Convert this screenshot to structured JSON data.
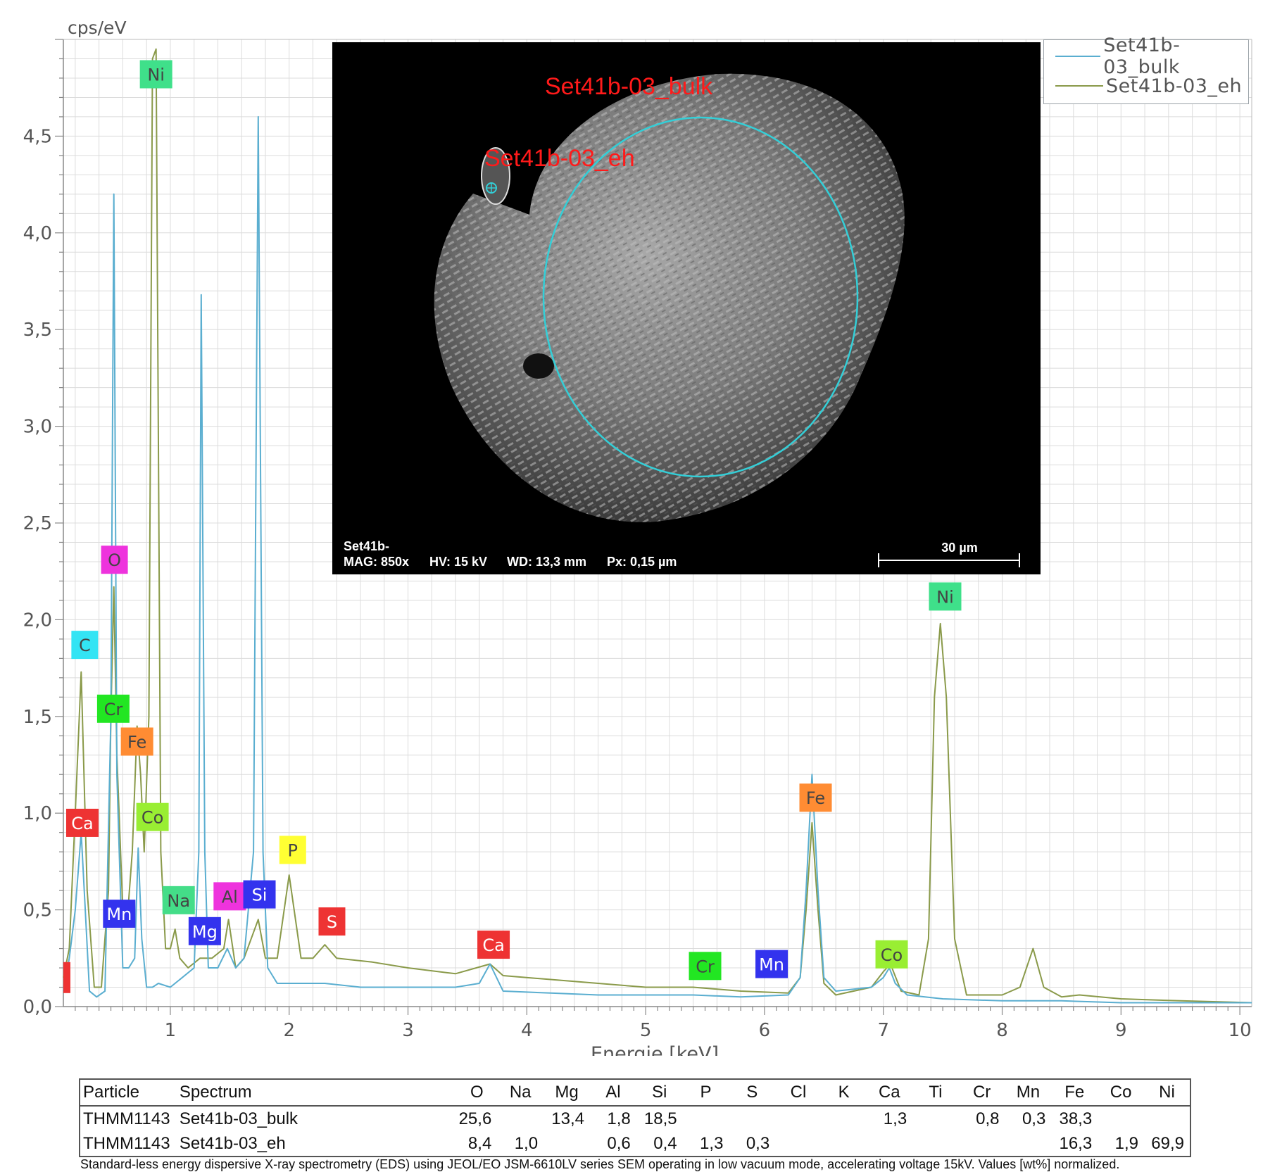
{
  "chart_data": {
    "type": "line",
    "ylabel": "cps/eV",
    "xlabel": "Energie [keV]",
    "xlim": [
      0.1,
      10.1
    ],
    "ylim": [
      0,
      5.0
    ],
    "x_ticks": [
      "1",
      "2",
      "3",
      "4",
      "5",
      "6",
      "7",
      "8",
      "9",
      "10"
    ],
    "y_ticks": [
      "0,0",
      "0,5",
      "1,0",
      "1,5",
      "2,0",
      "2,5",
      "3,0",
      "3,5",
      "4,0",
      "4,5"
    ],
    "grid": true,
    "legend_position": "top-right",
    "series": [
      {
        "name": "Set41b-03_bulk",
        "color": "#5aaed0",
        "points": [
          [
            0.1,
            0.08
          ],
          [
            0.15,
            0.25
          ],
          [
            0.2,
            0.5
          ],
          [
            0.25,
            0.9
          ],
          [
            0.28,
            0.55
          ],
          [
            0.32,
            0.08
          ],
          [
            0.38,
            0.05
          ],
          [
            0.45,
            0.08
          ],
          [
            0.5,
            1.5
          ],
          [
            0.525,
            4.2
          ],
          [
            0.55,
            1.2
          ],
          [
            0.6,
            0.2
          ],
          [
            0.65,
            0.2
          ],
          [
            0.7,
            0.25
          ],
          [
            0.73,
            0.82
          ],
          [
            0.76,
            0.35
          ],
          [
            0.8,
            0.1
          ],
          [
            0.85,
            0.1
          ],
          [
            0.9,
            0.12
          ],
          [
            1.0,
            0.1
          ],
          [
            1.1,
            0.15
          ],
          [
            1.2,
            0.2
          ],
          [
            1.24,
            0.8
          ],
          [
            1.26,
            3.68
          ],
          [
            1.29,
            0.8
          ],
          [
            1.32,
            0.2
          ],
          [
            1.4,
            0.2
          ],
          [
            1.48,
            0.3
          ],
          [
            1.55,
            0.2
          ],
          [
            1.62,
            0.25
          ],
          [
            1.7,
            0.8
          ],
          [
            1.74,
            4.6
          ],
          [
            1.78,
            0.8
          ],
          [
            1.82,
            0.2
          ],
          [
            1.9,
            0.12
          ],
          [
            2.0,
            0.12
          ],
          [
            2.3,
            0.12
          ],
          [
            2.6,
            0.1
          ],
          [
            3.0,
            0.1
          ],
          [
            3.4,
            0.1
          ],
          [
            3.6,
            0.12
          ],
          [
            3.69,
            0.22
          ],
          [
            3.8,
            0.08
          ],
          [
            4.2,
            0.07
          ],
          [
            4.6,
            0.06
          ],
          [
            5.0,
            0.06
          ],
          [
            5.4,
            0.06
          ],
          [
            5.8,
            0.05
          ],
          [
            6.2,
            0.06
          ],
          [
            6.3,
            0.15
          ],
          [
            6.35,
            0.6
          ],
          [
            6.4,
            1.2
          ],
          [
            6.45,
            0.6
          ],
          [
            6.5,
            0.15
          ],
          [
            6.6,
            0.08
          ],
          [
            6.9,
            0.1
          ],
          [
            7.0,
            0.15
          ],
          [
            7.05,
            0.2
          ],
          [
            7.1,
            0.12
          ],
          [
            7.2,
            0.06
          ],
          [
            7.5,
            0.04
          ],
          [
            8.0,
            0.03
          ],
          [
            8.5,
            0.03
          ],
          [
            9.0,
            0.02
          ],
          [
            10.1,
            0.02
          ]
        ]
      },
      {
        "name": "Set41b-03_eh",
        "color": "#8a9a4a",
        "points": [
          [
            0.1,
            0.15
          ],
          [
            0.15,
            0.3
          ],
          [
            0.2,
            1.0
          ],
          [
            0.25,
            1.73
          ],
          [
            0.3,
            0.6
          ],
          [
            0.36,
            0.1
          ],
          [
            0.42,
            0.1
          ],
          [
            0.48,
            0.6
          ],
          [
            0.5,
            1.5
          ],
          [
            0.525,
            2.17
          ],
          [
            0.55,
            1.3
          ],
          [
            0.6,
            0.5
          ],
          [
            0.65,
            0.55
          ],
          [
            0.68,
            0.8
          ],
          [
            0.72,
            1.45
          ],
          [
            0.75,
            1.2
          ],
          [
            0.78,
            0.8
          ],
          [
            0.82,
            1.5
          ],
          [
            0.85,
            4.9
          ],
          [
            0.88,
            4.95
          ],
          [
            0.92,
            0.8
          ],
          [
            0.96,
            0.3
          ],
          [
            1.0,
            0.3
          ],
          [
            1.04,
            0.4
          ],
          [
            1.08,
            0.25
          ],
          [
            1.15,
            0.2
          ],
          [
            1.25,
            0.25
          ],
          [
            1.35,
            0.25
          ],
          [
            1.45,
            0.3
          ],
          [
            1.49,
            0.45
          ],
          [
            1.55,
            0.2
          ],
          [
            1.62,
            0.25
          ],
          [
            1.74,
            0.45
          ],
          [
            1.8,
            0.25
          ],
          [
            1.9,
            0.25
          ],
          [
            2.0,
            0.68
          ],
          [
            2.1,
            0.25
          ],
          [
            2.2,
            0.25
          ],
          [
            2.3,
            0.32
          ],
          [
            2.4,
            0.25
          ],
          [
            2.7,
            0.23
          ],
          [
            3.0,
            0.2
          ],
          [
            3.4,
            0.17
          ],
          [
            3.69,
            0.22
          ],
          [
            3.8,
            0.16
          ],
          [
            4.2,
            0.14
          ],
          [
            4.6,
            0.12
          ],
          [
            5.0,
            0.1
          ],
          [
            5.4,
            0.1
          ],
          [
            5.8,
            0.08
          ],
          [
            6.2,
            0.07
          ],
          [
            6.3,
            0.15
          ],
          [
            6.35,
            0.5
          ],
          [
            6.4,
            0.95
          ],
          [
            6.45,
            0.5
          ],
          [
            6.5,
            0.12
          ],
          [
            6.6,
            0.06
          ],
          [
            6.9,
            0.1
          ],
          [
            7.0,
            0.18
          ],
          [
            7.06,
            0.22
          ],
          [
            7.15,
            0.08
          ],
          [
            7.3,
            0.06
          ],
          [
            7.38,
            0.35
          ],
          [
            7.43,
            1.6
          ],
          [
            7.48,
            1.98
          ],
          [
            7.53,
            1.6
          ],
          [
            7.6,
            0.35
          ],
          [
            7.7,
            0.06
          ],
          [
            8.0,
            0.06
          ],
          [
            8.15,
            0.1
          ],
          [
            8.26,
            0.3
          ],
          [
            8.35,
            0.1
          ],
          [
            8.5,
            0.05
          ],
          [
            8.65,
            0.06
          ],
          [
            9.0,
            0.04
          ],
          [
            9.5,
            0.03
          ],
          [
            10.1,
            0.02
          ]
        ]
      }
    ],
    "element_labels": [
      {
        "text": "Ni",
        "x": 0.88,
        "y": 4.82,
        "color": "#3fe08a"
      },
      {
        "text": "O",
        "x": 0.53,
        "y": 2.31,
        "color": "#ee33dd"
      },
      {
        "text": "C",
        "x": 0.28,
        "y": 1.87,
        "color": "#33e4f4"
      },
      {
        "text": "Cr",
        "x": 0.52,
        "y": 1.54,
        "color": "#22e622"
      },
      {
        "text": "Fe",
        "x": 0.72,
        "y": 1.37,
        "color": "#ff8c33"
      },
      {
        "text": "Ca",
        "x": 0.26,
        "y": 0.95,
        "color": "#ee3333"
      },
      {
        "text": "Co",
        "x": 0.85,
        "y": 0.98,
        "color": "#99ee33"
      },
      {
        "text": "Mn",
        "x": 0.57,
        "y": 0.48,
        "color": "#3333ee"
      },
      {
        "text": "Na",
        "x": 1.07,
        "y": 0.55,
        "color": "#44dd88"
      },
      {
        "text": "Mg",
        "x": 1.29,
        "y": 0.39,
        "color": "#3333ee"
      },
      {
        "text": "Al",
        "x": 1.5,
        "y": 0.57,
        "color": "#ee33dd"
      },
      {
        "text": "Si",
        "x": 1.75,
        "y": 0.58,
        "color": "#3333ee"
      },
      {
        "text": "P",
        "x": 2.03,
        "y": 0.81,
        "color": "#ffff33"
      },
      {
        "text": "S",
        "x": 2.36,
        "y": 0.44,
        "color": "#ee3333"
      },
      {
        "text": "Ca",
        "x": 3.72,
        "y": 0.32,
        "color": "#ee3333"
      },
      {
        "text": "Fe",
        "x": 6.43,
        "y": 1.08,
        "color": "#ff8c33"
      },
      {
        "text": "Ni",
        "x": 7.52,
        "y": 2.12,
        "color": "#3fe08a"
      },
      {
        "text": "Cr",
        "x": 5.5,
        "y": 0.21,
        "color": "#22e622"
      },
      {
        "text": "Mn",
        "x": 6.06,
        "y": 0.22,
        "color": "#3333ee"
      },
      {
        "text": "Co",
        "x": 7.07,
        "y": 0.27,
        "color": "#99ee33"
      }
    ]
  },
  "legend": {
    "items": [
      {
        "label": "Set41b-03_bulk",
        "color": "#5aaed0"
      },
      {
        "label": "Set41b-03_eh",
        "color": "#8a9a4a"
      }
    ]
  },
  "sem_image": {
    "region_bulk": "Set41b-03_bulk",
    "region_eh": "Set41b-03_eh",
    "sample": "Set41b-",
    "mag": "MAG: 850x",
    "hv": "HV: 15 kV",
    "wd": "WD: 13,3 mm",
    "px": "Px: 0,15 µm",
    "scale_bar": "30 µm"
  },
  "table": {
    "headers": [
      "Particle",
      "Spectrum",
      "O",
      "Na",
      "Mg",
      "Al",
      "Si",
      "P",
      "S",
      "Cl",
      "K",
      "Ca",
      "Ti",
      "Cr",
      "Mn",
      "Fe",
      "Co",
      "Ni"
    ],
    "rows": [
      [
        "THMM1143",
        "Set41b-03_bulk",
        "25,6",
        "",
        "13,4",
        "1,8",
        "18,5",
        "",
        "",
        "",
        "",
        "1,3",
        "",
        "0,8",
        "0,3",
        "38,3",
        "",
        ""
      ],
      [
        "THMM1143",
        "Set41b-03_eh",
        "8,4",
        "1,0",
        "",
        "0,6",
        "0,4",
        "1,3",
        "0,3",
        "",
        "",
        "",
        "",
        "",
        "",
        "16,3",
        "1,9",
        "69,9"
      ]
    ]
  },
  "footnote": "Standard-less energy dispersive X-ray spectrometry (EDS) using JEOL/EO JSM-6610LV series SEM operating in low vacuum mode, accelerating voltage 15kV. Values [wt%] normalized."
}
